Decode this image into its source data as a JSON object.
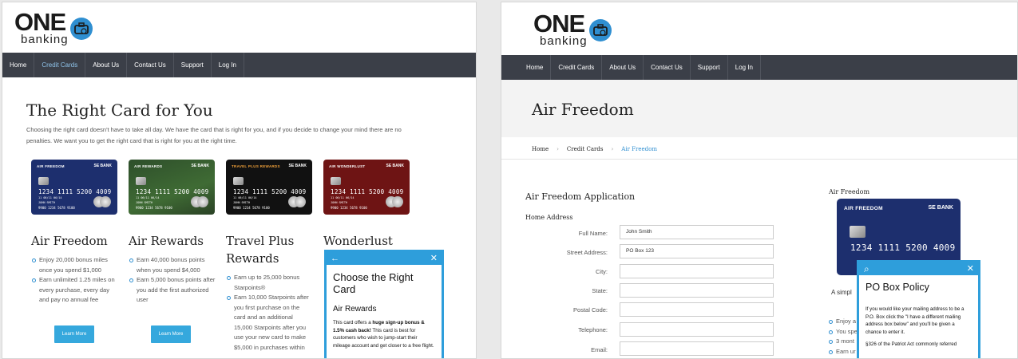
{
  "logo": {
    "word": "ONE",
    "sub": "banking"
  },
  "nav": [
    "Home",
    "Credit Cards",
    "About Us",
    "Contact Us",
    "Support",
    "Log In"
  ],
  "nav_active_left": "Credit Cards",
  "colors": {
    "accent": "#2e9edb",
    "nav": "#3b3f48",
    "button": "#35a8dd"
  },
  "left": {
    "title": "The Right Card for You",
    "intro": "Choosing the right card doesn't have to take all day. We have the card that is right for you, and if you decide to change your mind there are no penalties. We want you to get the right card that is right for you at the right time.",
    "cards": [
      {
        "card_label": "AIR FREEDOM",
        "bank": "SE BANK",
        "color": "#1d2f6e",
        "number": "1234 1111 5200 4009",
        "valid": "11  06/11  06/14",
        "holder": "JOHN SMITH",
        "extra": "9900 1234 5678 9100",
        "title": "Air Freedom",
        "bullets": [
          "Enjoy 20,000 bonus miles once you spend $1,000",
          "Earn unlimited 1.25 miles on every purchase, every day and pay no annual fee"
        ],
        "button": "Learn More"
      },
      {
        "card_label": "AIR REWARDS",
        "bank": "SE BANK",
        "color": "#2e4f2b",
        "number": "1234 1111 5200 4009",
        "valid": "11  06/11  06/14",
        "holder": "JOHN SMITH",
        "extra": "9900 1234 5678 9100",
        "title": "Air Rewards",
        "bullets": [
          "Earn 40,000 bonus points when you spend $4,000",
          "Earn 5,000 bonus points after you add the first authorized user"
        ],
        "button": "Learn More"
      },
      {
        "card_label": "TRAVEL PLUS REWARDS",
        "bank": "SE BANK",
        "color": "#111111",
        "number": "1234 1111 5200 4009",
        "valid": "11  06/11  06/14",
        "holder": "JOHN SMITH",
        "extra": "9900 1234 5678 9100",
        "title": "Travel Plus Rewards",
        "bullets": [
          "Earn up to 25,000 bonus Starpoints®",
          "Earn 10,000 Starpoints after you first purchase on the card and an additional 15,000 Starpoints after you use your new card to make $5,000 in purchases within"
        ]
      },
      {
        "card_label": "AIR WONDERLUST",
        "bank": "SE BANK",
        "color": "#6e1414",
        "number": "1234 1111 5200 4009",
        "valid": "11  06/11  06/14",
        "holder": "JOHN SMITH",
        "extra": "9900 1234 5678 9100",
        "title": "Wonderlust"
      }
    ],
    "popup": {
      "back_icon": "←",
      "close_icon": "✕",
      "title": "Choose the Right Card",
      "subtitle": "Air Rewards",
      "body_pre": "This card offers a ",
      "body_b1": "huge sign-up bonus & 1.5% cash back!",
      "body_post": " This card is best for customers who wish to jump-start their mileage account and get closer to a free flight."
    }
  },
  "right": {
    "page_title": "Air Freedom",
    "breadcrumb": [
      "Home",
      "Credit Cards",
      "Air Freedom"
    ],
    "form_title": "Air Freedom Application",
    "section": "Home Address",
    "fields": [
      {
        "label": "Full Name:",
        "value": "John Smith"
      },
      {
        "label": "Street Address:",
        "value": "PO Box 123"
      },
      {
        "label": "City:",
        "value": ""
      },
      {
        "label": "State:",
        "value": ""
      },
      {
        "label": "Postal Code:",
        "value": ""
      },
      {
        "label": "Telephone:",
        "value": ""
      },
      {
        "label": "Email:",
        "value": ""
      }
    ],
    "side_title": "Air Freedom",
    "side_card": {
      "card_label": "AIR FREEDOM",
      "bank": "SE BANK",
      "number": "1234 1111 5200 4009"
    },
    "side_text": "A simpl",
    "side_bullets": [
      "Enjoy a",
      "You spe",
      "3 mont",
      "Earn ur"
    ],
    "popup": {
      "search_icon": "⌕",
      "close_icon": "✕",
      "title": "PO Box Policy",
      "p1": "If you would like your mailing address to be a P.O. Box click the \"I have a different mailing address box below\" and you'll be given a chance to enter it.",
      "p2": "§326 of the Patriot Act commonly referred"
    }
  }
}
